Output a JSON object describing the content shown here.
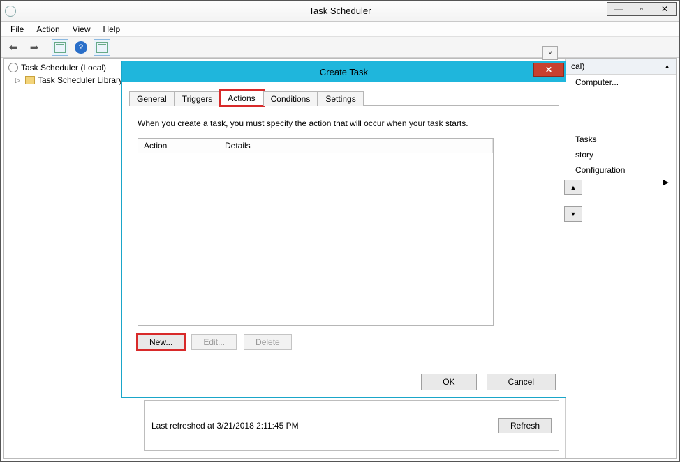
{
  "window": {
    "title": "Task Scheduler",
    "controls": {
      "min": "—",
      "max": "▫",
      "close": "✕"
    }
  },
  "menu": {
    "file": "File",
    "action": "Action",
    "view": "View",
    "help": "Help"
  },
  "tree": {
    "root": "Task Scheduler (Local)",
    "child": "Task Scheduler Library"
  },
  "actions_pane": {
    "header": "cal)",
    "items": {
      "computer": "Computer...",
      "tasks": "Tasks",
      "history": "story",
      "config": "Configuration"
    }
  },
  "status": {
    "last_refreshed": "Last refreshed at 3/21/2018 2:11:45 PM",
    "refresh": "Refresh"
  },
  "dialog": {
    "title": "Create Task",
    "tabs": {
      "general": "General",
      "triggers": "Triggers",
      "actions": "Actions",
      "conditions": "Conditions",
      "settings": "Settings"
    },
    "instruction": "When you create a task, you must specify the action that will occur when your task starts.",
    "columns": {
      "action": "Action",
      "details": "Details"
    },
    "buttons": {
      "new": "New...",
      "edit": "Edit...",
      "delete": "Delete",
      "ok": "OK",
      "cancel": "Cancel",
      "up": "▲",
      "down": "▼"
    }
  }
}
